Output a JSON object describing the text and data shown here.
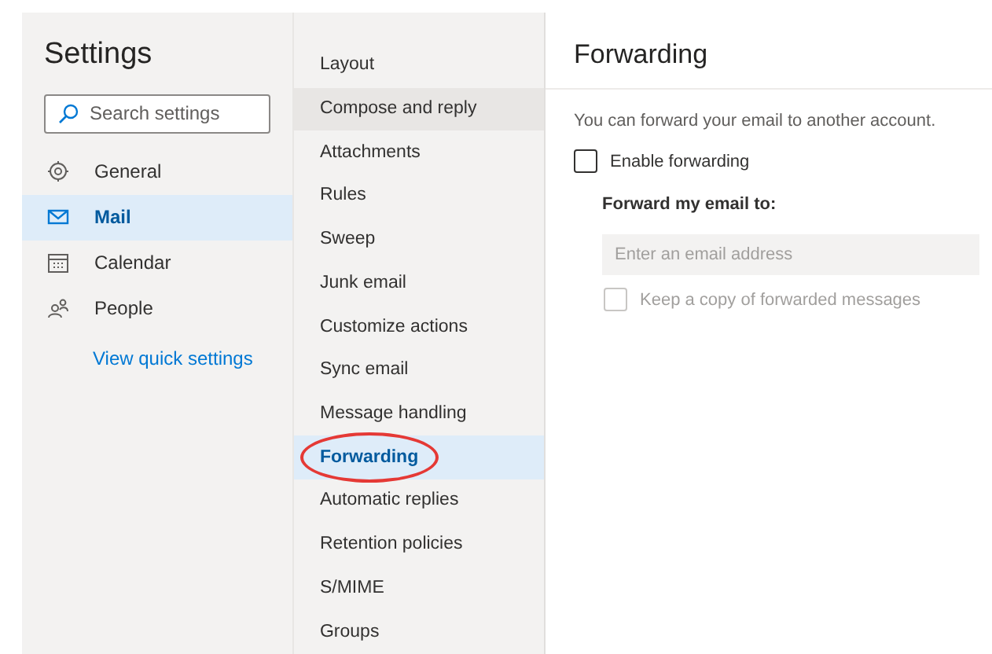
{
  "sidebar": {
    "title": "Settings",
    "search": {
      "placeholder": "Search settings"
    },
    "items": [
      {
        "label": "General",
        "selected": false
      },
      {
        "label": "Mail",
        "selected": true
      },
      {
        "label": "Calendar",
        "selected": false
      },
      {
        "label": "People",
        "selected": false
      }
    ],
    "link": "View quick settings"
  },
  "submenu": {
    "items": [
      {
        "label": "Layout",
        "selected": false,
        "hovered": false,
        "circled": false
      },
      {
        "label": "Compose and reply",
        "selected": false,
        "hovered": true,
        "circled": false
      },
      {
        "label": "Attachments",
        "selected": false,
        "hovered": false,
        "circled": false
      },
      {
        "label": "Rules",
        "selected": false,
        "hovered": false,
        "circled": false
      },
      {
        "label": "Sweep",
        "selected": false,
        "hovered": false,
        "circled": false
      },
      {
        "label": "Junk email",
        "selected": false,
        "hovered": false,
        "circled": false
      },
      {
        "label": "Customize actions",
        "selected": false,
        "hovered": false,
        "circled": false
      },
      {
        "label": "Sync email",
        "selected": false,
        "hovered": false,
        "circled": false
      },
      {
        "label": "Message handling",
        "selected": false,
        "hovered": false,
        "circled": false
      },
      {
        "label": "Forwarding",
        "selected": true,
        "hovered": false,
        "circled": true
      },
      {
        "label": "Automatic replies",
        "selected": false,
        "hovered": false,
        "circled": false
      },
      {
        "label": "Retention policies",
        "selected": false,
        "hovered": false,
        "circled": false
      },
      {
        "label": "S/MIME",
        "selected": false,
        "hovered": false,
        "circled": false
      },
      {
        "label": "Groups",
        "selected": false,
        "hovered": false,
        "circled": false
      }
    ]
  },
  "panel": {
    "title": "Forwarding",
    "description": "You can forward your email to another account.",
    "enable": {
      "label": "Enable forwarding",
      "checked": false
    },
    "field_label": "Forward my email to:",
    "email": {
      "placeholder": "Enter an email address",
      "disabled": true
    },
    "keep_copy": {
      "label": "Keep a copy of forwarded messages",
      "checked": false,
      "disabled": true
    }
  }
}
